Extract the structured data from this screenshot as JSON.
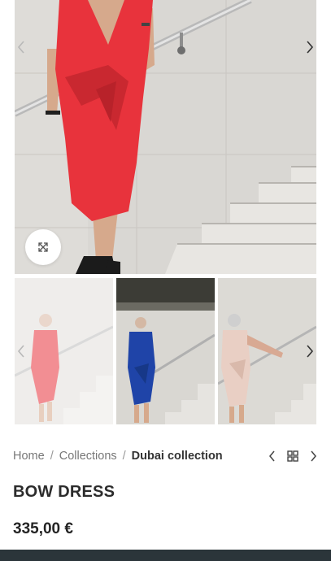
{
  "gallery": {
    "main_image_alt": "Red bow dress on staircase",
    "thumbnails": [
      {
        "color_name": "red",
        "color": "#e8333c"
      },
      {
        "color_name": "blue",
        "color": "#1f44a8"
      },
      {
        "color_name": "nude",
        "color": "#e9cfc4"
      }
    ],
    "zoom_icon": "expand-icon",
    "prev_icon": "chevron-left-icon",
    "next_icon": "chevron-right-icon"
  },
  "breadcrumb": {
    "items": [
      "Home",
      "Collections"
    ],
    "separator": "/",
    "current": "Dubai collection"
  },
  "product_nav": {
    "prev_icon": "chevron-left-icon",
    "grid_icon": "grid-icon",
    "next_icon": "chevron-right-icon"
  },
  "product": {
    "title": "BOW DRESS",
    "price": "335,00 €"
  },
  "colors": {
    "accent_red": "#e8333c",
    "bottom_bar": "#2b353a"
  }
}
